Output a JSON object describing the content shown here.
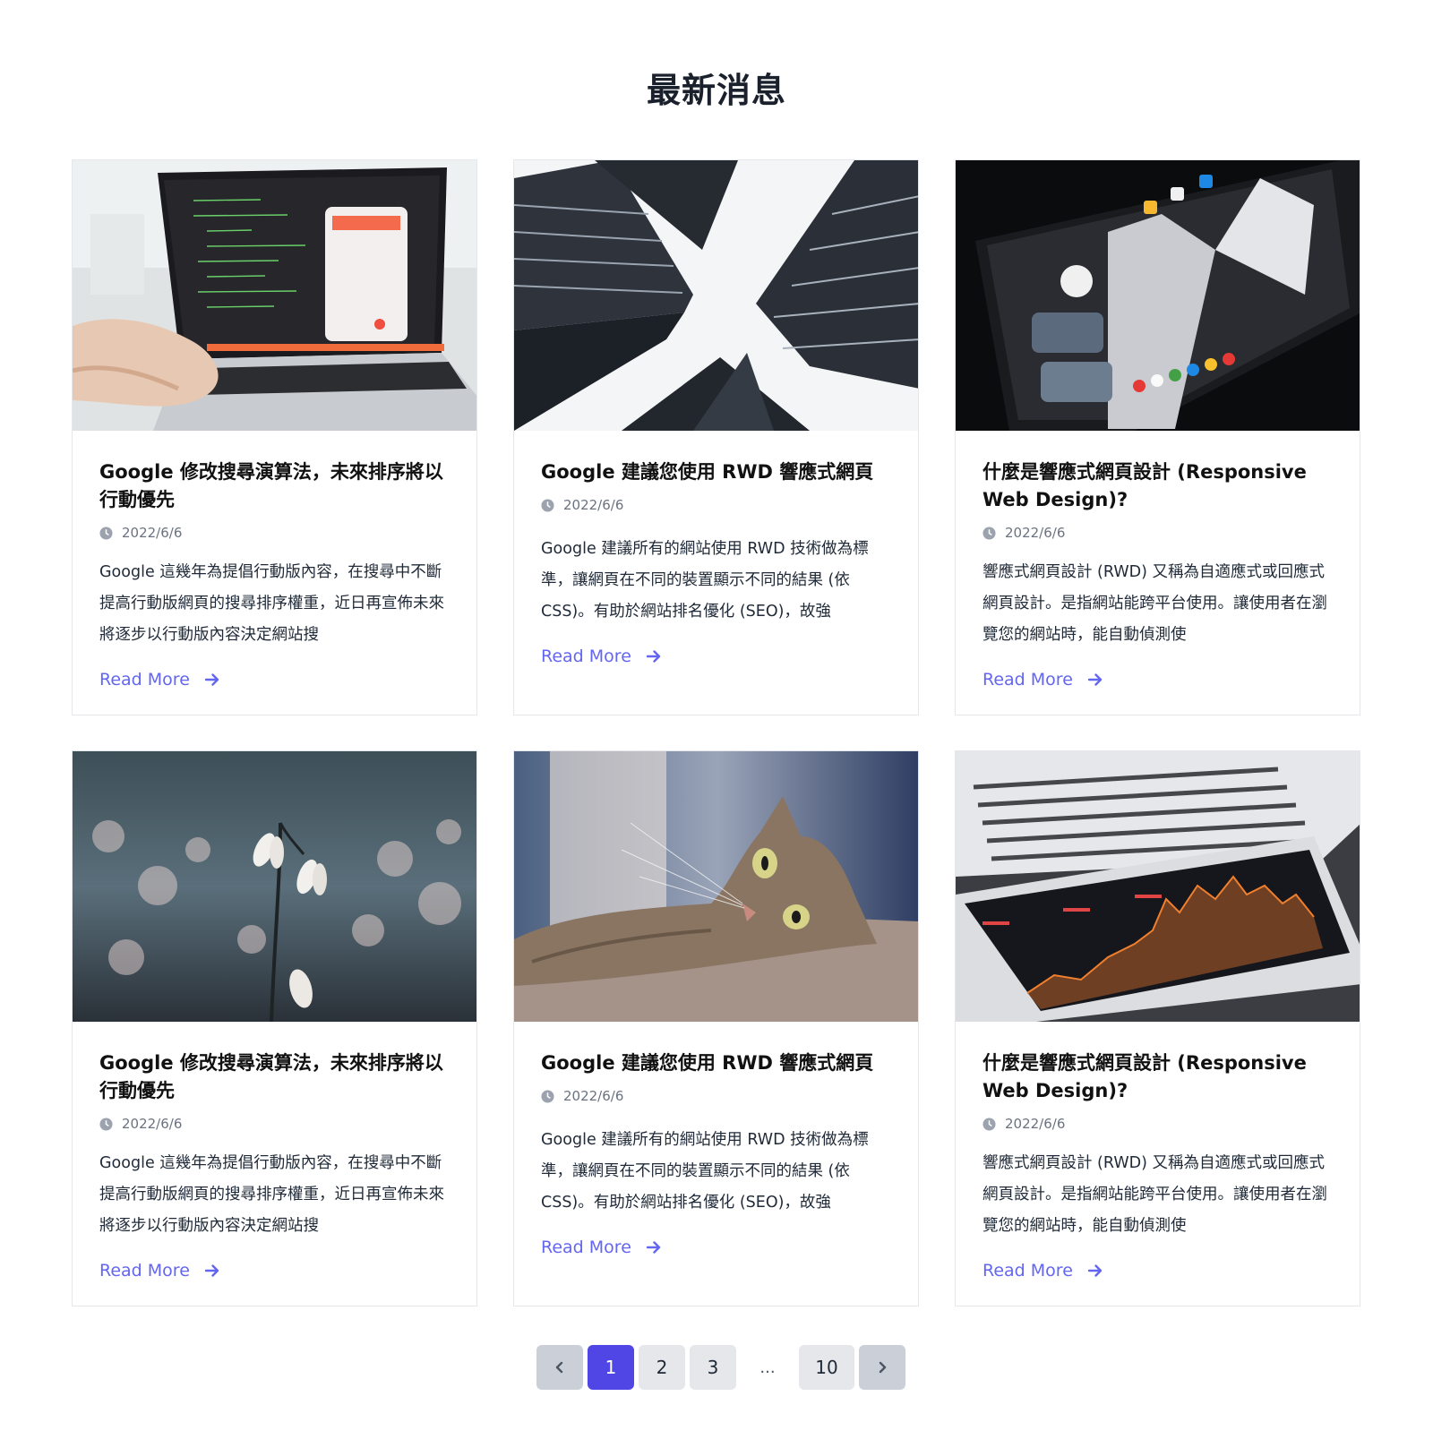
{
  "section": {
    "title": "最新消息"
  },
  "cards": [
    {
      "title": "Google 修改搜尋演算法，未來排序將以行動優先",
      "date": "2022/6/6",
      "excerpt": "Google 這幾年為提倡行動版內容，在搜尋中不斷提高行動版網頁的搜尋排序權重，近日再宣佈未來將逐步以行動版內容決定網站搜",
      "read_more": "Read More",
      "image": "laptop-coding"
    },
    {
      "title": "Google 建議您使用 RWD 響應式網頁設計",
      "date": "2022/6/6",
      "excerpt": "Google 建議所有的網站使用 RWD 技術做為標準，讓網頁在不同的裝置顯示不同的結果 (依 CSS)。有助於網站排名優化 (SEO)，故強",
      "read_more": "Read More",
      "image": "skyscrapers"
    },
    {
      "title": "什麼是響應式網頁設計 (Responsive Web Design)?",
      "date": "2022/6/6",
      "excerpt": "響應式網頁設計 (RWD) 又稱為自適應式或回應式網頁設計。是指網站能跨平台使用。讓使用者在瀏覽您的網站時，能自動偵測使",
      "read_more": "Read More",
      "image": "tablet-homescreen"
    },
    {
      "title": "Google 修改搜尋演算法，未來排序將以行動優先",
      "date": "2022/6/6",
      "excerpt": "Google 這幾年為提倡行動版內容，在搜尋中不斷提高行動版網頁的搜尋排序權重，近日再宣佈未來將逐步以行動版內容決定網站搜",
      "read_more": "Read More",
      "image": "snowdrop-flowers"
    },
    {
      "title": "Google 建議您使用 RWD 響應式網頁設計",
      "date": "2022/6/6",
      "excerpt": "Google 建議所有的網站使用 RWD 技術做為標準，讓網頁在不同的裝置顯示不同的結果 (依 CSS)。有助於網站排名優化 (SEO)，故強",
      "read_more": "Read More",
      "image": "cat"
    },
    {
      "title": "什麼是響應式網頁設計 (Responsive Web Design)?",
      "date": "2022/6/6",
      "excerpt": "響應式網頁設計 (RWD) 又稱為自適應式或回應式網頁設計。是指網站能跨平台使用。讓使用者在瀏覽您的網站時，能自動偵測使",
      "read_more": "Read More",
      "image": "tablet-chart"
    }
  ],
  "pagination": {
    "prev_icon": "chevron-left-icon",
    "next_icon": "chevron-right-icon",
    "pages": [
      "1",
      "2",
      "3",
      "...",
      "10"
    ],
    "current": "1"
  },
  "colors": {
    "accent": "#4f46e5",
    "link": "#6366f1",
    "border": "#e5e7eb"
  }
}
